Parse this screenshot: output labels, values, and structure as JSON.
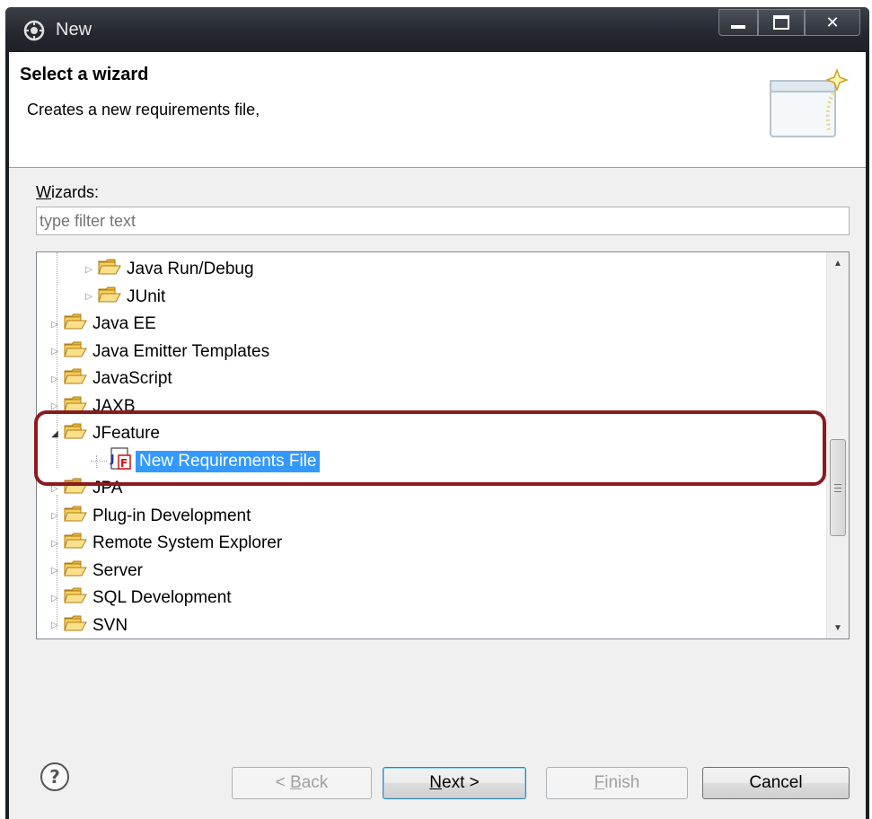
{
  "window": {
    "title": "New"
  },
  "header": {
    "title": "Select a wizard",
    "description": "Creates a new requirements file,"
  },
  "wizards": {
    "label_u": "W",
    "label_rest": "izards:",
    "filter_placeholder": "type filter text"
  },
  "tree": {
    "items": [
      {
        "label": "Java Run/Debug",
        "level": 1,
        "type": "folder",
        "expanded": false
      },
      {
        "label": "JUnit",
        "level": 1,
        "type": "folder",
        "expanded": false
      },
      {
        "label": "Java EE",
        "level": 0,
        "type": "folder",
        "expanded": false
      },
      {
        "label": "Java Emitter Templates",
        "level": 0,
        "type": "folder",
        "expanded": false
      },
      {
        "label": "JavaScript",
        "level": 0,
        "type": "folder",
        "expanded": false
      },
      {
        "label": "JAXB",
        "level": 0,
        "type": "folder",
        "expanded": false
      },
      {
        "label": "JFeature",
        "level": 0,
        "type": "folder",
        "expanded": true
      },
      {
        "label": "New Requirements File",
        "level": 1,
        "type": "file",
        "selected": true
      },
      {
        "label": "JPA",
        "level": 0,
        "type": "folder",
        "expanded": false
      },
      {
        "label": "Plug-in Development",
        "level": 0,
        "type": "folder",
        "expanded": false
      },
      {
        "label": "Remote System Explorer",
        "level": 0,
        "type": "folder",
        "expanded": false
      },
      {
        "label": "Server",
        "level": 0,
        "type": "folder",
        "expanded": false
      },
      {
        "label": "SQL Development",
        "level": 0,
        "type": "folder",
        "expanded": false
      },
      {
        "label": "SVN",
        "level": 0,
        "type": "folder",
        "expanded": false
      }
    ]
  },
  "buttons": {
    "back_prefix": "< ",
    "back_u": "B",
    "back_rest": "ack",
    "next_u": "N",
    "next_rest": "ext >",
    "finish_u": "F",
    "finish_rest": "inish",
    "cancel": "Cancel"
  },
  "colors": {
    "selection": "#3399ff",
    "highlight_border": "#8b1a1f",
    "folder": "#f5c542"
  }
}
